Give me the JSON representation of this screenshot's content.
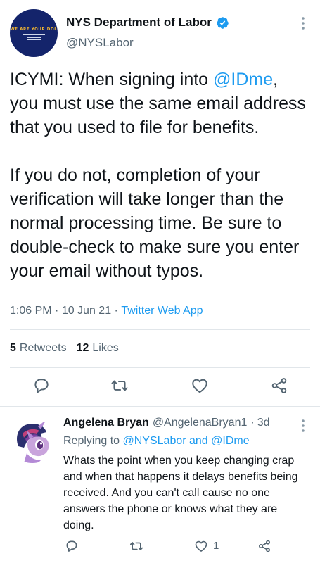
{
  "tweet": {
    "display_name": "NYS Department of Labor",
    "handle": "@NYSLabor",
    "avatar_logo_text": "WE ARE YOUR DOL",
    "text_part1": "ICYMI: When signing into ",
    "mention": "@IDme",
    "text_part2": ",\nyou must use the same email address that you used to file for benefits.\n\nIf you do not, completion of your verification will take longer than the normal processing time. Be sure to double-check to make sure you enter your email without typos.",
    "time": "1:06 PM",
    "date": "10 Jun 21",
    "app": "Twitter Web App",
    "retweets_count": "5",
    "retweets_label": "Retweets",
    "likes_count": "12",
    "likes_label": "Likes"
  },
  "reply": {
    "display_name": "Angelena Bryan",
    "handle": "@AngelenaBryan1",
    "age": "3d",
    "replying_prefix": "Replying to ",
    "replying_to_1": "@NYSLabor",
    "replying_and": " and ",
    "replying_to_2": "@IDme",
    "text": "Whats the point when you keep changing crap and when that happens it delays benefits being received. And you can't call cause no one answers the phone or knows what they are doing.",
    "like_count": "1"
  },
  "colors": {
    "accent": "#1d9bf0",
    "secondary_text": "#536471",
    "primary_text": "#0f1419",
    "divider": "#e1e6ea"
  },
  "icons": [
    "verified-badge-icon",
    "more-options-icon",
    "reply-icon",
    "retweet-icon",
    "like-icon",
    "share-icon"
  ]
}
